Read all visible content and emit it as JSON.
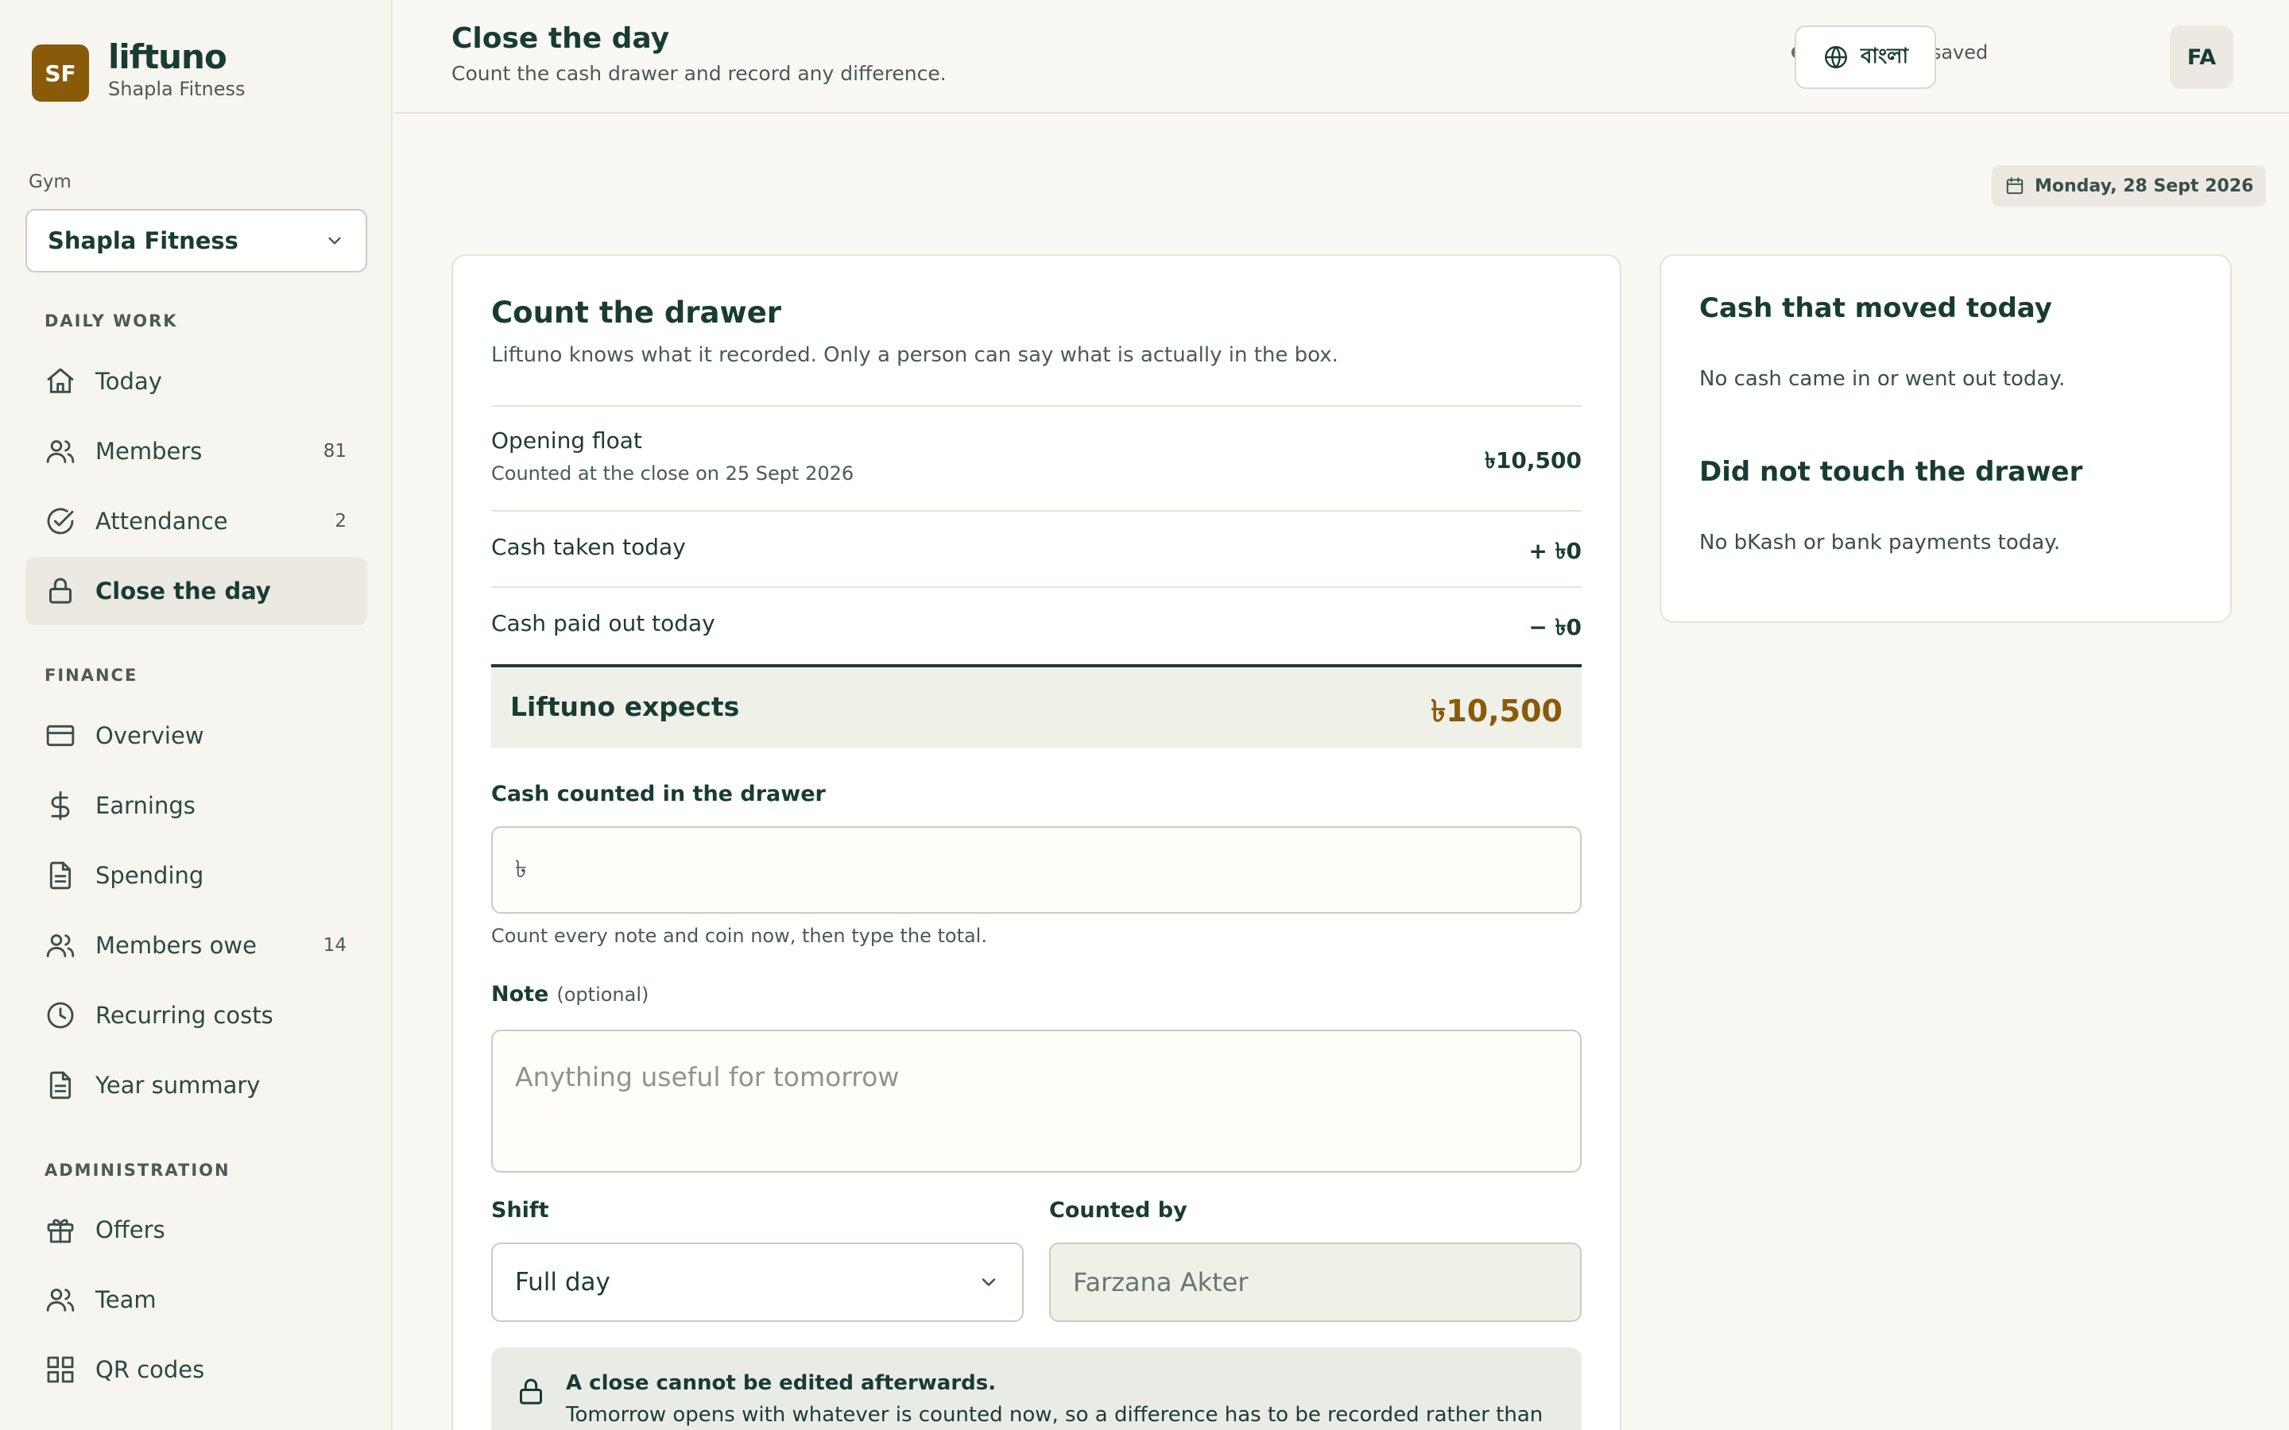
{
  "brand": {
    "initials": "SF",
    "name": "liftuno",
    "gym": "Shapla Fitness"
  },
  "gym_select": {
    "label": "Gym",
    "value": "Shapla Fitness"
  },
  "nav": {
    "daily_work": {
      "heading": "DAILY WORK",
      "items": [
        {
          "label": "Today",
          "count": "",
          "icon": "home-icon"
        },
        {
          "label": "Members",
          "count": "81",
          "icon": "users-icon"
        },
        {
          "label": "Attendance",
          "count": "2",
          "icon": "check-circle-icon"
        },
        {
          "label": "Close the day",
          "count": "",
          "icon": "lock-icon",
          "active": true
        }
      ]
    },
    "finance": {
      "heading": "FINANCE",
      "items": [
        {
          "label": "Overview",
          "count": "",
          "icon": "credit-card-icon"
        },
        {
          "label": "Earnings",
          "count": "",
          "icon": "dollar-icon"
        },
        {
          "label": "Spending",
          "count": "",
          "icon": "document-icon"
        },
        {
          "label": "Members owe",
          "count": "14",
          "icon": "users-icon"
        },
        {
          "label": "Recurring costs",
          "count": "",
          "icon": "clock-icon"
        },
        {
          "label": "Year summary",
          "count": "",
          "icon": "document-icon"
        }
      ]
    },
    "administration": {
      "heading": "ADMINISTRATION",
      "items": [
        {
          "label": "Offers",
          "count": "",
          "icon": "gift-icon"
        },
        {
          "label": "Team",
          "count": "",
          "icon": "users-icon"
        },
        {
          "label": "QR codes",
          "count": "",
          "icon": "grid-icon"
        }
      ]
    }
  },
  "header": {
    "title": "Close the day",
    "subtitle": "Count the cash drawer and record any difference.",
    "status": "All changes saved",
    "language_button": "বাংলা",
    "avatar": "FA"
  },
  "date": "Monday, 28 Sept 2026",
  "drawer": {
    "title": "Count the drawer",
    "subtitle": "Liftuno knows what it recorded. Only a person can say what is actually in the box.",
    "opening_float": {
      "label": "Opening float",
      "sub": "Counted at the close on 25 Sept 2026",
      "value": "৳10,500"
    },
    "cash_taken": {
      "label": "Cash taken today",
      "value": "+ ৳0"
    },
    "cash_paid": {
      "label": "Cash paid out today",
      "value": "− ৳0"
    },
    "expects": {
      "label": "Liftuno expects",
      "value": "৳10,500"
    },
    "counted": {
      "label": "Cash counted in the drawer",
      "prefix": "৳",
      "value": "",
      "hint": "Count every note and coin now, then type the total."
    },
    "note": {
      "label": "Note",
      "optional": "(optional)",
      "placeholder": "Anything useful for tomorrow"
    },
    "shift": {
      "label": "Shift",
      "value": "Full day"
    },
    "counted_by": {
      "label": "Counted by",
      "value": "Farzana Akter"
    },
    "warning": {
      "title": "A close cannot be edited afterwards.",
      "body": "Tomorrow opens with whatever is counted now, so a difference has to be recorded rather than"
    }
  },
  "side": {
    "moved_title": "Cash that moved today",
    "moved_text": "No cash came in or went out today.",
    "untouched_title": "Did not touch the drawer",
    "untouched_text": "No bKash or bank payments today."
  },
  "colors": {
    "accent": "#8a5a0b",
    "ink": "#183c32",
    "background": "#faf8f4"
  }
}
